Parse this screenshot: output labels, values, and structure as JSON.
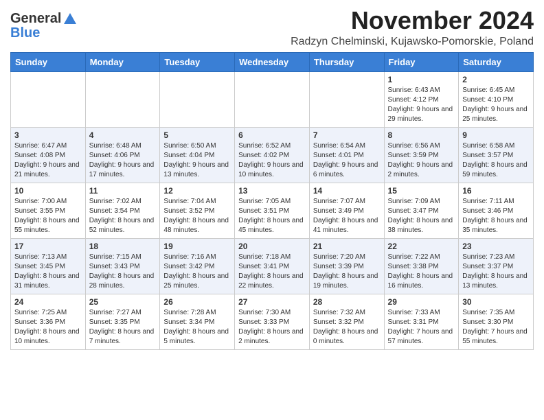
{
  "header": {
    "logo_general": "General",
    "logo_blue": "Blue",
    "month_title": "November 2024",
    "location": "Radzyn Chelminski, Kujawsko-Pomorskie, Poland"
  },
  "weekdays": [
    "Sunday",
    "Monday",
    "Tuesday",
    "Wednesday",
    "Thursday",
    "Friday",
    "Saturday"
  ],
  "weeks": [
    [
      {
        "day": "",
        "info": ""
      },
      {
        "day": "",
        "info": ""
      },
      {
        "day": "",
        "info": ""
      },
      {
        "day": "",
        "info": ""
      },
      {
        "day": "",
        "info": ""
      },
      {
        "day": "1",
        "info": "Sunrise: 6:43 AM\nSunset: 4:12 PM\nDaylight: 9 hours and 29 minutes."
      },
      {
        "day": "2",
        "info": "Sunrise: 6:45 AM\nSunset: 4:10 PM\nDaylight: 9 hours and 25 minutes."
      }
    ],
    [
      {
        "day": "3",
        "info": "Sunrise: 6:47 AM\nSunset: 4:08 PM\nDaylight: 9 hours and 21 minutes."
      },
      {
        "day": "4",
        "info": "Sunrise: 6:48 AM\nSunset: 4:06 PM\nDaylight: 9 hours and 17 minutes."
      },
      {
        "day": "5",
        "info": "Sunrise: 6:50 AM\nSunset: 4:04 PM\nDaylight: 9 hours and 13 minutes."
      },
      {
        "day": "6",
        "info": "Sunrise: 6:52 AM\nSunset: 4:02 PM\nDaylight: 9 hours and 10 minutes."
      },
      {
        "day": "7",
        "info": "Sunrise: 6:54 AM\nSunset: 4:01 PM\nDaylight: 9 hours and 6 minutes."
      },
      {
        "day": "8",
        "info": "Sunrise: 6:56 AM\nSunset: 3:59 PM\nDaylight: 9 hours and 2 minutes."
      },
      {
        "day": "9",
        "info": "Sunrise: 6:58 AM\nSunset: 3:57 PM\nDaylight: 8 hours and 59 minutes."
      }
    ],
    [
      {
        "day": "10",
        "info": "Sunrise: 7:00 AM\nSunset: 3:55 PM\nDaylight: 8 hours and 55 minutes."
      },
      {
        "day": "11",
        "info": "Sunrise: 7:02 AM\nSunset: 3:54 PM\nDaylight: 8 hours and 52 minutes."
      },
      {
        "day": "12",
        "info": "Sunrise: 7:04 AM\nSunset: 3:52 PM\nDaylight: 8 hours and 48 minutes."
      },
      {
        "day": "13",
        "info": "Sunrise: 7:05 AM\nSunset: 3:51 PM\nDaylight: 8 hours and 45 minutes."
      },
      {
        "day": "14",
        "info": "Sunrise: 7:07 AM\nSunset: 3:49 PM\nDaylight: 8 hours and 41 minutes."
      },
      {
        "day": "15",
        "info": "Sunrise: 7:09 AM\nSunset: 3:47 PM\nDaylight: 8 hours and 38 minutes."
      },
      {
        "day": "16",
        "info": "Sunrise: 7:11 AM\nSunset: 3:46 PM\nDaylight: 8 hours and 35 minutes."
      }
    ],
    [
      {
        "day": "17",
        "info": "Sunrise: 7:13 AM\nSunset: 3:45 PM\nDaylight: 8 hours and 31 minutes."
      },
      {
        "day": "18",
        "info": "Sunrise: 7:15 AM\nSunset: 3:43 PM\nDaylight: 8 hours and 28 minutes."
      },
      {
        "day": "19",
        "info": "Sunrise: 7:16 AM\nSunset: 3:42 PM\nDaylight: 8 hours and 25 minutes."
      },
      {
        "day": "20",
        "info": "Sunrise: 7:18 AM\nSunset: 3:41 PM\nDaylight: 8 hours and 22 minutes."
      },
      {
        "day": "21",
        "info": "Sunrise: 7:20 AM\nSunset: 3:39 PM\nDaylight: 8 hours and 19 minutes."
      },
      {
        "day": "22",
        "info": "Sunrise: 7:22 AM\nSunset: 3:38 PM\nDaylight: 8 hours and 16 minutes."
      },
      {
        "day": "23",
        "info": "Sunrise: 7:23 AM\nSunset: 3:37 PM\nDaylight: 8 hours and 13 minutes."
      }
    ],
    [
      {
        "day": "24",
        "info": "Sunrise: 7:25 AM\nSunset: 3:36 PM\nDaylight: 8 hours and 10 minutes."
      },
      {
        "day": "25",
        "info": "Sunrise: 7:27 AM\nSunset: 3:35 PM\nDaylight: 8 hours and 7 minutes."
      },
      {
        "day": "26",
        "info": "Sunrise: 7:28 AM\nSunset: 3:34 PM\nDaylight: 8 hours and 5 minutes."
      },
      {
        "day": "27",
        "info": "Sunrise: 7:30 AM\nSunset: 3:33 PM\nDaylight: 8 hours and 2 minutes."
      },
      {
        "day": "28",
        "info": "Sunrise: 7:32 AM\nSunset: 3:32 PM\nDaylight: 8 hours and 0 minutes."
      },
      {
        "day": "29",
        "info": "Sunrise: 7:33 AM\nSunset: 3:31 PM\nDaylight: 7 hours and 57 minutes."
      },
      {
        "day": "30",
        "info": "Sunrise: 7:35 AM\nSunset: 3:30 PM\nDaylight: 7 hours and 55 minutes."
      }
    ]
  ]
}
